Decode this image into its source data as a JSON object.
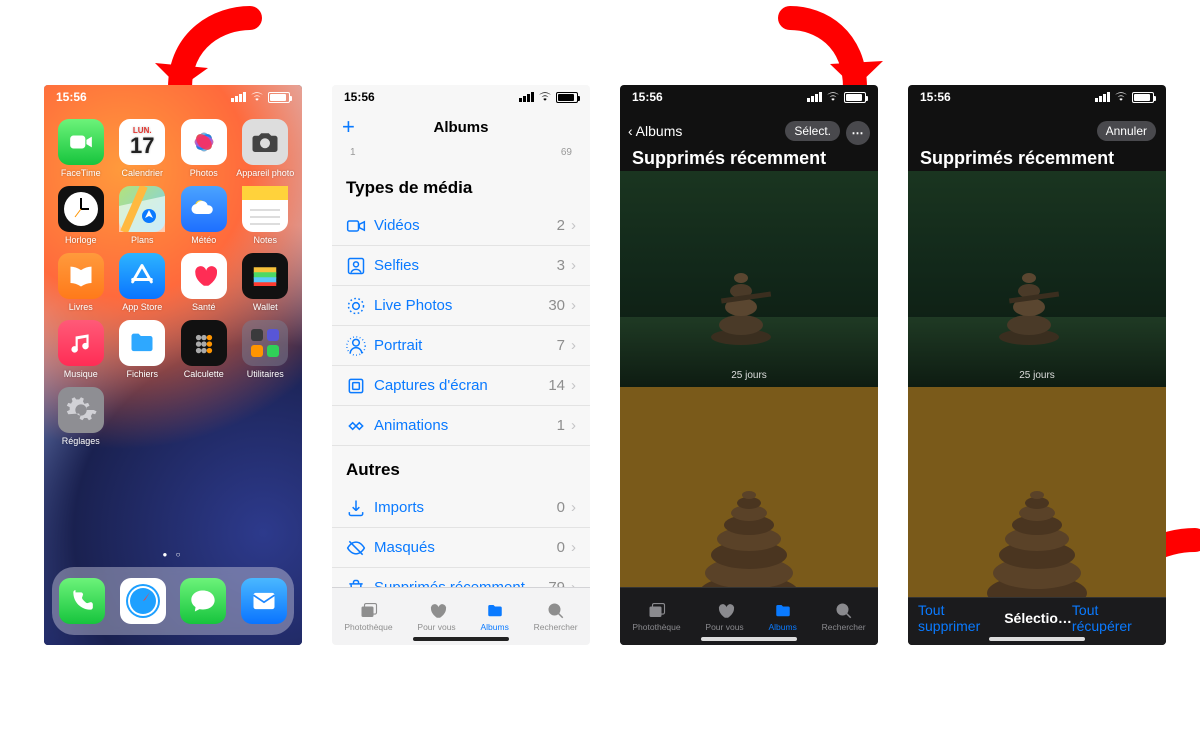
{
  "status": {
    "time": "15:56"
  },
  "home": {
    "apps": [
      {
        "label": "FaceTime",
        "icon": "facetime"
      },
      {
        "label": "Calendrier",
        "icon": "calendar",
        "day": "LUN.",
        "date": "17"
      },
      {
        "label": "Photos",
        "icon": "photos"
      },
      {
        "label": "Appareil photo",
        "icon": "camera"
      },
      {
        "label": "Horloge",
        "icon": "clock"
      },
      {
        "label": "Plans",
        "icon": "maps"
      },
      {
        "label": "Météo",
        "icon": "weather"
      },
      {
        "label": "Notes",
        "icon": "notes"
      },
      {
        "label": "Livres",
        "icon": "books"
      },
      {
        "label": "App Store",
        "icon": "appstore"
      },
      {
        "label": "Santé",
        "icon": "health"
      },
      {
        "label": "Wallet",
        "icon": "wallet"
      },
      {
        "label": "Musique",
        "icon": "music"
      },
      {
        "label": "Fichiers",
        "icon": "files"
      },
      {
        "label": "Calculette",
        "icon": "calculator"
      },
      {
        "label": "Utilitaires",
        "icon": "utilities"
      },
      {
        "label": "Réglages",
        "icon": "settings"
      }
    ],
    "dock": [
      {
        "label": "Téléphone",
        "icon": "phone"
      },
      {
        "label": "Safari",
        "icon": "safari"
      },
      {
        "label": "Messages",
        "icon": "messages"
      },
      {
        "label": "Mail",
        "icon": "mail"
      }
    ]
  },
  "albums_screen": {
    "title": "Albums",
    "tiny_left": "1",
    "tiny_right": "69",
    "sections": {
      "media_types": {
        "header": "Types de média",
        "items": [
          {
            "label": "Vidéos",
            "count": "2"
          },
          {
            "label": "Selfies",
            "count": "3"
          },
          {
            "label": "Live Photos",
            "count": "30"
          },
          {
            "label": "Portrait",
            "count": "7"
          },
          {
            "label": "Captures d'écran",
            "count": "14"
          },
          {
            "label": "Animations",
            "count": "1"
          }
        ]
      },
      "autres": {
        "header": "Autres",
        "items": [
          {
            "label": "Imports",
            "count": "0"
          },
          {
            "label": "Masqués",
            "count": "0"
          },
          {
            "label": "Supprimés récemment",
            "count": "79"
          }
        ]
      }
    }
  },
  "tabs": [
    {
      "label": "Photothèque"
    },
    {
      "label": "Pour vous"
    },
    {
      "label": "Albums"
    },
    {
      "label": "Rechercher"
    }
  ],
  "deleted": {
    "back_label": "Albums",
    "title": "Supprimés récemment",
    "select_btn": "Sélect.",
    "cancel_btn": "Annuler",
    "days_remaining": "25 jours"
  },
  "bottom_actions": {
    "delete_all": "Tout supprimer",
    "selection": "Sélectio…",
    "recover_all": "Tout récupérer"
  }
}
